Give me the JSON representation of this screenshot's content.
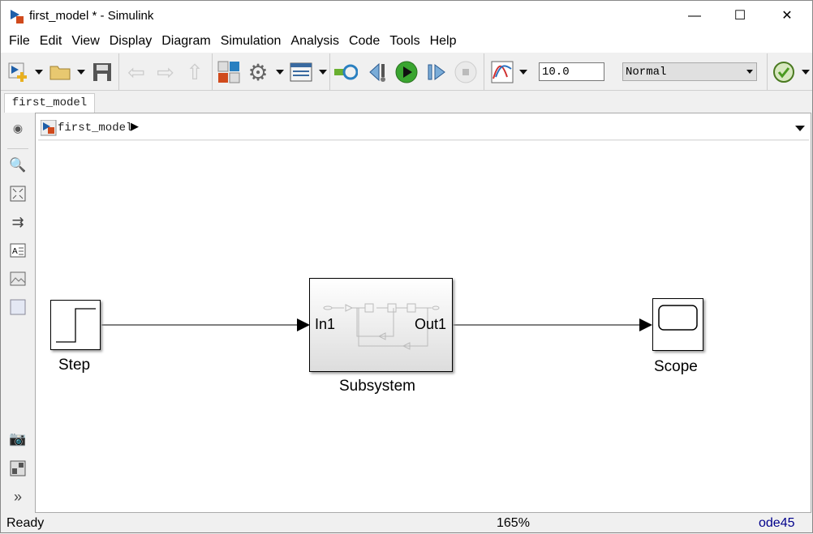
{
  "window": {
    "title": "first_model * - Simulink"
  },
  "menu": [
    "File",
    "Edit",
    "View",
    "Display",
    "Diagram",
    "Simulation",
    "Analysis",
    "Code",
    "Tools",
    "Help"
  ],
  "toolbar": {
    "stop_time": "10.0",
    "sim_mode": "Normal",
    "icons": [
      "new-model",
      "open",
      "save",
      "back",
      "forward",
      "up",
      "library-browser",
      "model-config",
      "model-explorer",
      "step-back",
      "run",
      "step-forward",
      "stop",
      "data-inspector",
      "model-advisor"
    ]
  },
  "tabs": [
    {
      "label": "first_model"
    }
  ],
  "breadcrumb": {
    "model": "first_model"
  },
  "diagram": {
    "blocks": [
      {
        "name": "Step"
      },
      {
        "name": "Subsystem",
        "in_port": "In1",
        "out_port": "Out1"
      },
      {
        "name": "Scope"
      }
    ]
  },
  "status": {
    "state": "Ready",
    "zoom": "165%",
    "solver": "ode45"
  },
  "colors": {
    "accent": "#1f5fa8",
    "run_green": "#3aa530",
    "solver_text": "#00008b"
  }
}
